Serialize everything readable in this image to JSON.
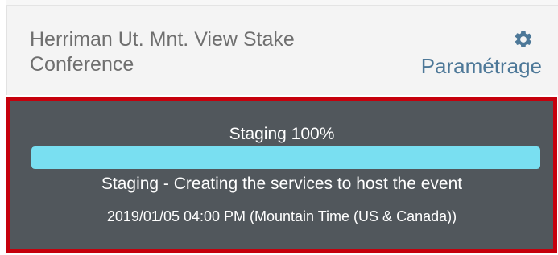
{
  "header": {
    "event_title": "Herriman Ut. Mnt. View Stake Conference",
    "settings_label": "Paramétrage",
    "settings_icon": "gear-icon"
  },
  "status": {
    "progress_label": "Staging 100%",
    "progress_percent": 100,
    "message": "Staging - Creating the services to host the event",
    "schedule": "2019/01/05 04:00 PM (Mountain Time (US & Canada))"
  },
  "colors": {
    "panel_background": "#51575c",
    "panel_border": "#c6000c",
    "progress_fill": "#79dff1",
    "accent": "#4d7898"
  }
}
